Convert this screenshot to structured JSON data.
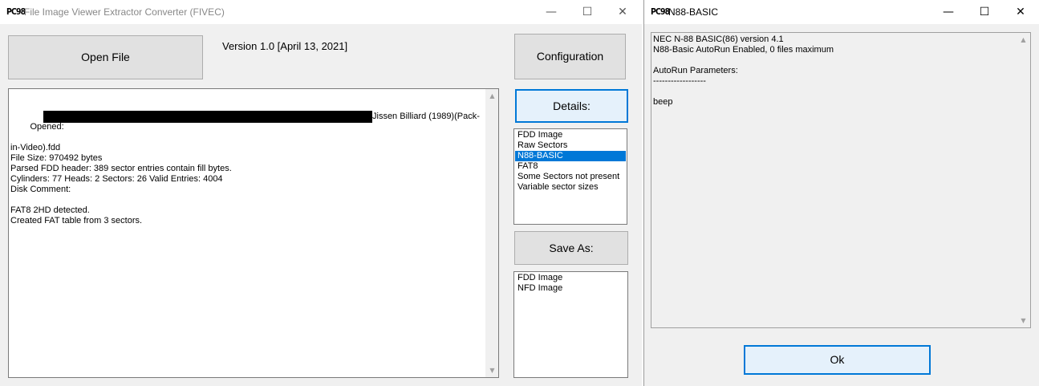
{
  "main_window": {
    "title": "File Image Viewer Extractor Converter (FIVEC)",
    "app_icon_text": "PC98",
    "minimize_glyph": "—",
    "maximize_glyph": "☐",
    "close_glyph": "✕",
    "open_file_label": "Open File",
    "version_text": "Version  1.0 [April 13, 2021]",
    "configuration_label": "Configuration",
    "details_label": "Details:",
    "save_as_label": "Save As:",
    "log_opened_prefix": "Opened:",
    "log_opened_suffix": "Jissen Billiard (1989)(Pack-",
    "log_rest": "in-Video).fdd\nFile Size: 970492 bytes\nParsed FDD header: 389 sector entries contain fill bytes.\nCylinders: 77 Heads: 2 Sectors: 26 Valid Entries: 4004\nDisk Comment:\n\nFAT8 2HD detected.\nCreated FAT table from 3 sectors.",
    "details_items": [
      "FDD Image",
      "Raw Sectors",
      "N88-BASIC",
      "FAT8",
      "Some Sectors not present",
      "Variable sector sizes"
    ],
    "details_selected": "N88-BASIC",
    "save_items": [
      "FDD Image",
      "NFD Image"
    ]
  },
  "dialog": {
    "title": "N88-BASIC",
    "app_icon_text": "PC98",
    "minimize_glyph": "—",
    "maximize_glyph": "☐",
    "close_glyph": "✕",
    "text": "NEC N-88 BASIC(86) version 4.1\nN88-Basic AutoRun Enabled, 0 files maximum\n\nAutoRun Parameters:\n------------------\n\nbeep",
    "ok_label": "Ok"
  },
  "scroll_up_glyph": "▲",
  "scroll_down_glyph": "▼",
  "colors": {
    "selection": "#0078d7",
    "focus_border": "#0078d7",
    "window_bg": "#f0f0f0",
    "button_bg": "#e1e1e1"
  }
}
